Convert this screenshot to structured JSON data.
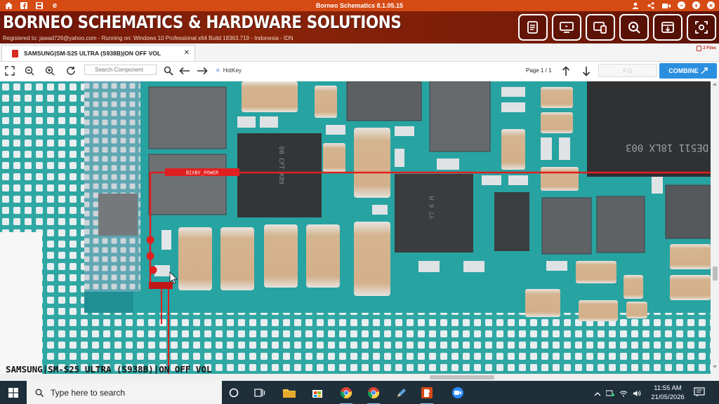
{
  "window": {
    "title": "Borneo Schematics 8.1.05.15",
    "left_icons": [
      "home-icon",
      "facebook-icon",
      "save-icon",
      "edge-icon"
    ],
    "right_icons": [
      "user-icon",
      "share-icon",
      "video-icon",
      "minimize-icon",
      "maximize-icon",
      "close-icon"
    ]
  },
  "header": {
    "brand": "BORNEO SCHEMATICS & HARDWARE SOLUTIONS",
    "registration": "Registered to: jawad726@yahoo.com - Running on: Windows 10 Professional x64 Build 18363.719 - Indonesia - IDN",
    "buttons": [
      "schematic-list-icon",
      "monitor-icon",
      "devices-icon",
      "search-zoom-icon",
      "update-icon",
      "capture-icon"
    ]
  },
  "tabs": [
    {
      "label": "SAMSUNG|SM-S25 ULTRA (S938B)|ON OFF VOL",
      "active": true
    }
  ],
  "files_badge": "2 Files",
  "toolbar": {
    "search_placeholder": "Search Component",
    "hotkey_label": "HotKey",
    "page_label": "Page 1 / 1",
    "combine_label": "COMBINE",
    "grey_field": "F-D"
  },
  "board": {
    "net_label": "BIXBY_POWER",
    "caption": "SAMSUNG|SM-S25 ULTRA (S938B)|ON OFF VOL",
    "chip_markings": [
      "D8\nCFT\nK89",
      "DE511\n18LX\n003",
      "YT\nK\nM"
    ]
  },
  "taskbar": {
    "search_placeholder": "Type here to search",
    "time": "11:55 AM",
    "date": "21/05/2026",
    "apps": [
      "task-view-icon",
      "file-explorer-icon",
      "store-icon",
      "chrome-icon",
      "chrome-profile-icon",
      "pencil-app-icon",
      "borneo-app-icon",
      "zoom-icon"
    ]
  },
  "colors": {
    "title_bar": "#d64a14",
    "header_bg": "#7a1d08",
    "board_teal": "#2fa7a3",
    "trace_red": "#e02020",
    "combine_blue": "#2b8fe0",
    "taskbar": "#1f2f3a"
  }
}
